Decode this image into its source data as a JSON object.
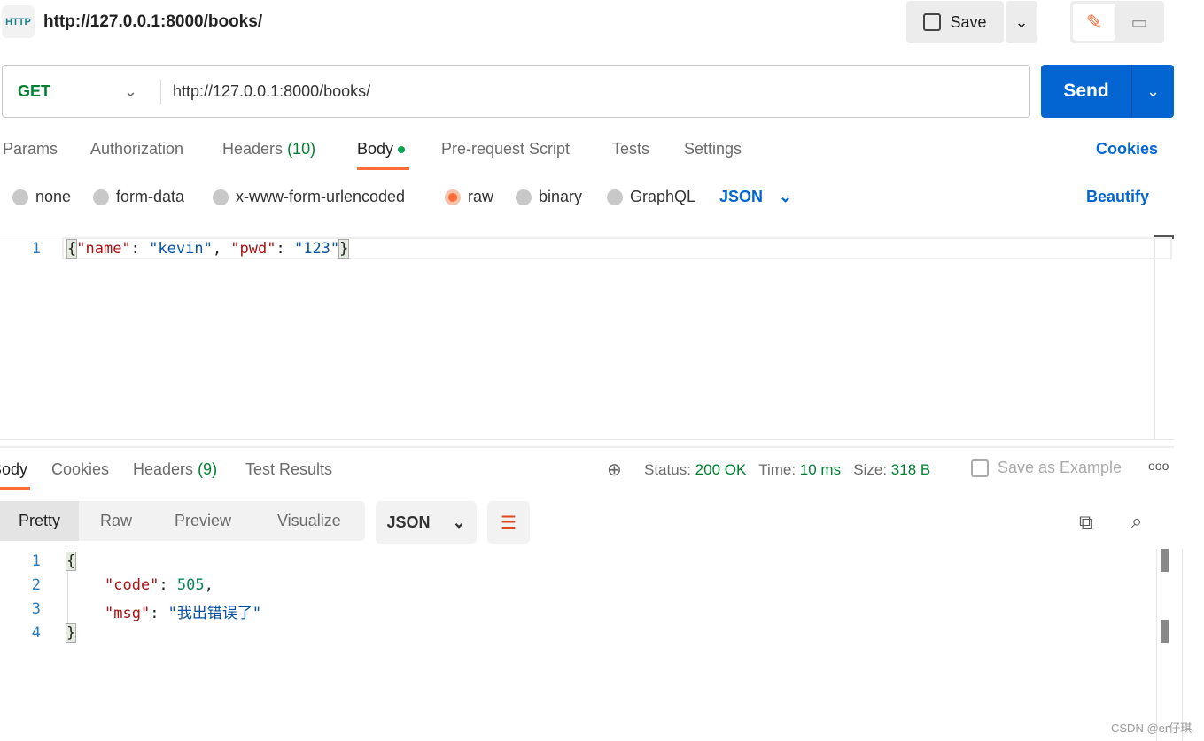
{
  "header": {
    "icon": "http-icon",
    "title": "http://127.0.0.1:8000/books/",
    "save_label": "Save"
  },
  "request": {
    "method": "GET",
    "url": "http://127.0.0.1:8000/books/",
    "send_label": "Send"
  },
  "req_tabs": [
    {
      "label": "Params"
    },
    {
      "label": "Authorization"
    },
    {
      "label": "Headers",
      "count": "(10)"
    },
    {
      "label": "Body"
    },
    {
      "label": "Pre-request Script"
    },
    {
      "label": "Tests"
    },
    {
      "label": "Settings"
    }
  ],
  "cookies_label": "Cookies",
  "body_types": [
    "none",
    "form-data",
    "x-www-form-urlencoded",
    "raw",
    "binary",
    "GraphQL"
  ],
  "selected_body_type": "raw",
  "body_format": "JSON",
  "beautify_label": "Beautify",
  "request_body": {
    "line": "1",
    "open": "{",
    "k1": "\"name\"",
    "v1": "\"kevin\"",
    "k2": "\"pwd\"",
    "v2": "\"123\"",
    "close": "}"
  },
  "resp_tabs": [
    {
      "label": "Body"
    },
    {
      "label": "Cookies"
    },
    {
      "label": "Headers",
      "count": "(9)"
    },
    {
      "label": "Test Results"
    }
  ],
  "status": {
    "status_label": "Status:",
    "status": "200 OK",
    "time_label": "Time:",
    "time": "10 ms",
    "size_label": "Size:",
    "size": "318 B",
    "save_example": "Save as Example"
  },
  "view_modes": [
    "Pretty",
    "Raw",
    "Preview",
    "Visualize"
  ],
  "resp_format": "JSON",
  "response": {
    "lines": [
      "1",
      "2",
      "3",
      "4"
    ],
    "open": "{",
    "k1": "\"code\"",
    "v1": "505",
    "k2": "\"msg\"",
    "v2": "\"我出错误了\"",
    "close": "}"
  },
  "watermark": "CSDN @er仔琪",
  "colors": {
    "accent": "#ff6c37",
    "send": "#0265d2",
    "green": "#007f31"
  }
}
